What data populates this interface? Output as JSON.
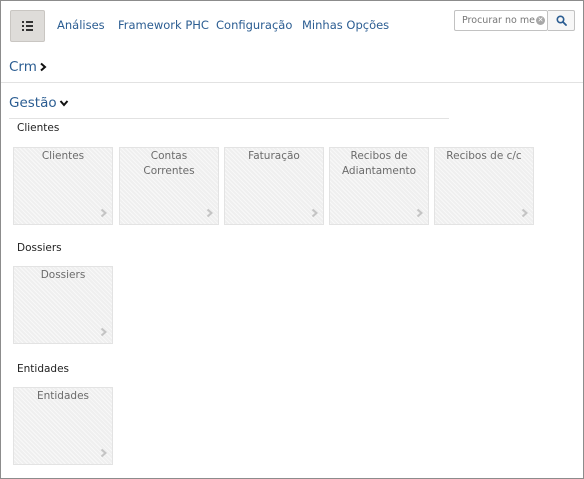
{
  "nav": {
    "links": [
      "Análises",
      "Framework PHC",
      "Configuração",
      "Minhas Opções"
    ]
  },
  "search": {
    "placeholder": "Procurar no menu"
  },
  "breadcrumb": {
    "label": "Crm"
  },
  "section": {
    "label": "Gestão"
  },
  "groups": [
    {
      "title": "Clientes",
      "tiles": [
        "Clientes",
        "Contas Correntes",
        "Faturação",
        "Recibos de Adiantamento",
        "Recibos de c/c"
      ]
    },
    {
      "title": "Dossiers",
      "tiles": [
        "Dossiers"
      ]
    },
    {
      "title": "Entidades",
      "tiles": [
        "Entidades"
      ]
    }
  ],
  "colors": {
    "link": "#2b5d92",
    "tile": "#efefef",
    "arrow": "#c4c4c4"
  },
  "icons": {
    "menu": "list-icon",
    "search": "search-icon",
    "clear": "clear-icon",
    "breadcrumb": "chevron-right-icon",
    "section": "chevron-down-icon",
    "tile": "chevron-right-icon"
  }
}
